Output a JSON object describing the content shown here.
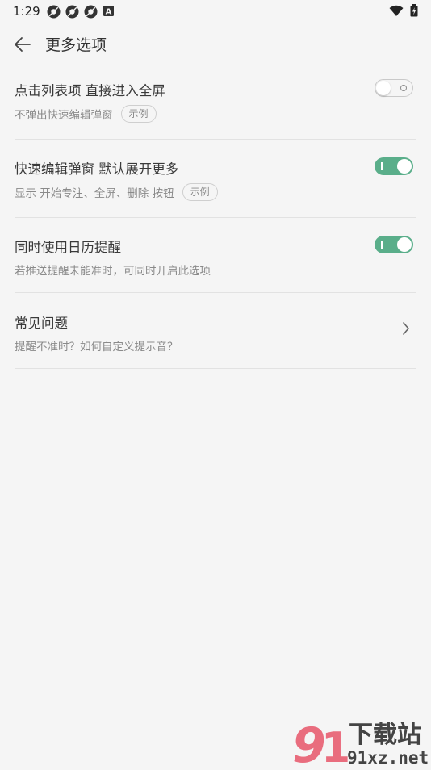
{
  "status_bar": {
    "time": "1:29",
    "notif_badge": "A"
  },
  "header": {
    "title": "更多选项"
  },
  "settings": [
    {
      "title": "点击列表项 直接进入全屏",
      "subtitle": "不弹出快速编辑弹窗",
      "chip": "示例",
      "control": "toggle",
      "enabled": false
    },
    {
      "title": "快速编辑弹窗 默认展开更多",
      "subtitle": "显示 开始专注、全屏、删除 按钮",
      "chip": "示例",
      "control": "toggle",
      "enabled": true
    },
    {
      "title": "同时使用日历提醒",
      "subtitle": "若推送提醒未能准时，可同时开启此选项",
      "control": "toggle",
      "enabled": true
    },
    {
      "title": "常见问题",
      "subtitle": "提醒不准时？如何自定义提示音？",
      "control": "chevron"
    }
  ],
  "watermark": {
    "text_cn": "下载站",
    "text_url": "91xz.net"
  },
  "colors": {
    "accent": "#5aae8a",
    "background": "#f5f5f5",
    "divider": "#e2e2e2"
  }
}
